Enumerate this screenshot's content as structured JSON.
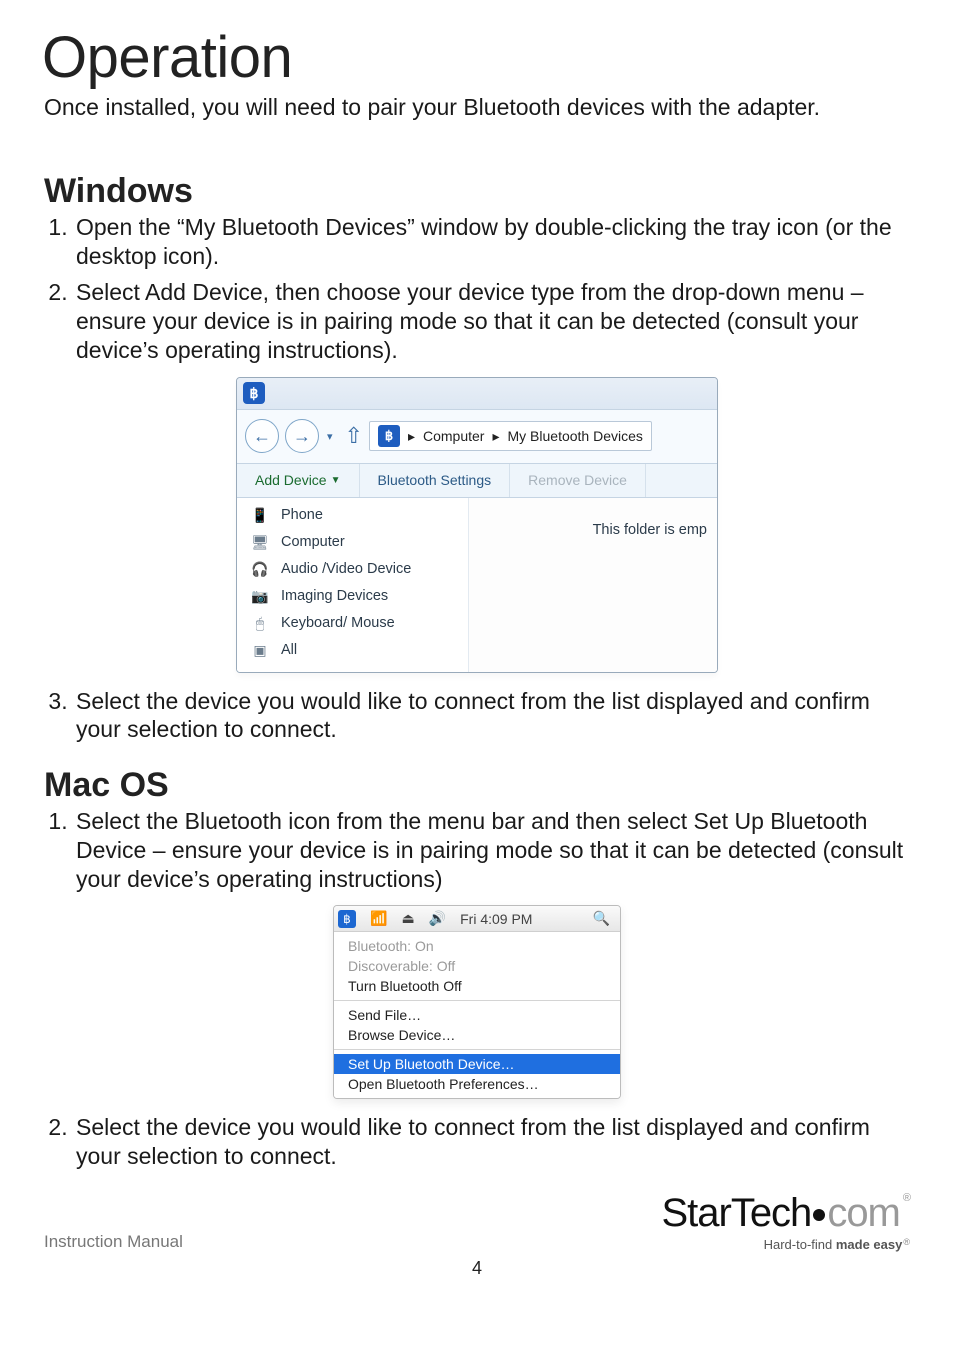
{
  "heading": "Operation",
  "intro": "Once installed, you will need to pair your Bluetooth devices with the adapter.",
  "windows": {
    "title": "Windows",
    "steps": [
      "Open the “My Bluetooth Devices” window by double-clicking the tray icon (or the desktop icon).",
      "Select Add Device, then choose your device type from the drop-down menu – ensure your device is in pairing mode so that it can be detected (consult your device’s operating instructions).",
      "Select the device you would like to connect from the list displayed and confirm your selection to connect."
    ],
    "breadcrumb": {
      "part1": "Computer",
      "part2": "My Bluetooth Devices"
    },
    "toolbar": {
      "add": "Add Device",
      "settings": "Bluetooth Settings",
      "remove": "Remove Device"
    },
    "dropdown": [
      "Phone",
      "Computer",
      "Audio /Video Device",
      "Imaging Devices",
      "Keyboard/ Mouse",
      "All"
    ],
    "emptyText": "This folder is emp"
  },
  "mac": {
    "title": "Mac OS",
    "steps": [
      "Select the Bluetooth icon from the menu bar and then select Set Up Bluetooth Device – ensure your device is in pairing mode so that it can be detected (consult your device’s operating instructions)",
      "Select the device you would like to connect from the list displayed and confirm your selection to connect."
    ],
    "menubar": {
      "time": "Fri 4:09 PM"
    },
    "menu": {
      "status1": "Bluetooth: On",
      "status2": "Discoverable: Off",
      "toggle": "Turn Bluetooth Off",
      "send": "Send File…",
      "browse": "Browse Device…",
      "setup": "Set Up Bluetooth Device…",
      "prefs": "Open Bluetooth Preferences…"
    }
  },
  "footer": {
    "instr": "Instruction Manual",
    "page": "4",
    "brand": {
      "main1": "StarTech",
      "main2": "com",
      "tagline_prefix": "Hard-to-find ",
      "tagline_bold": "made easy"
    }
  }
}
